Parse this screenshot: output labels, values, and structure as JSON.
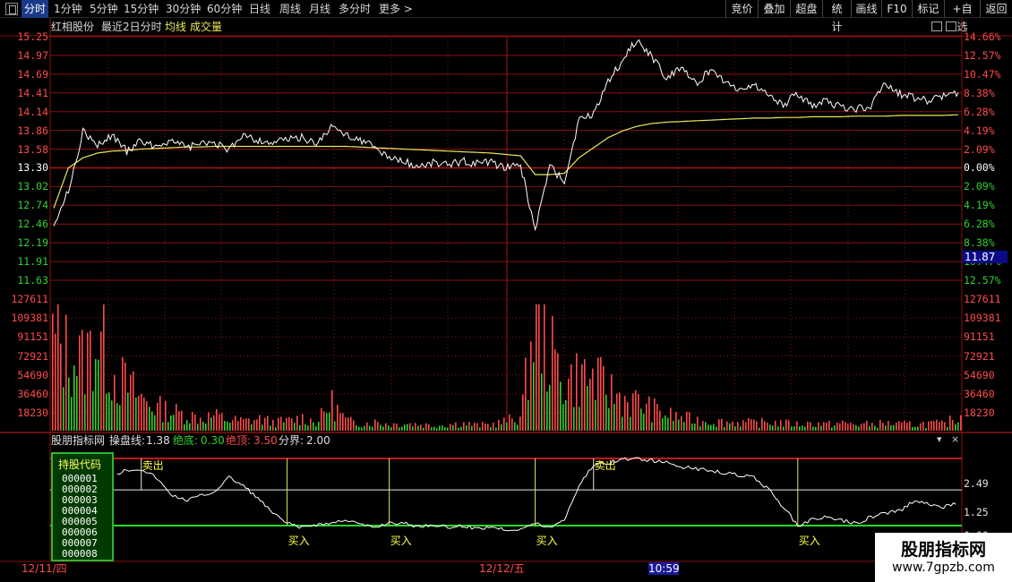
{
  "toolbar": {
    "periods": [
      "分时",
      "1分钟",
      "5分钟",
      "15分钟",
      "30分钟",
      "60分钟",
      "日线",
      "周线",
      "月线",
      "多分时",
      "更多 >"
    ],
    "right_buttons": [
      "竞价",
      "叠加",
      "超盘",
      "统计",
      "画线",
      "F10",
      "标记",
      "+自选",
      "返回"
    ]
  },
  "title": {
    "stock_name": "红相股份",
    "view": "最近2日分时",
    "avg_line": "均线",
    "volume": "成交量"
  },
  "price_axis": {
    "left": [
      "15.25",
      "14.97",
      "14.69",
      "14.41",
      "14.14",
      "13.86",
      "13.58",
      "13.30",
      "13.02",
      "12.74",
      "12.46",
      "12.19",
      "11.91",
      "11.63"
    ],
    "right": [
      "14.66%",
      "12.57%",
      "10.47%",
      "8.38%",
      "6.28%",
      "4.19%",
      "2.09%",
      "0.00%",
      "2.09%",
      "4.19%",
      "6.28%",
      "8.38%",
      "10.47%",
      "12.57%"
    ],
    "right_colors": [
      "#ff4a4a",
      "#ff4a4a",
      "#ff4a4a",
      "#ff4a4a",
      "#ff4a4a",
      "#ff4a4a",
      "#ff4a4a",
      "#ffffff",
      "#2fd12f",
      "#2fd12f",
      "#2fd12f",
      "#2fd12f",
      "#2fd12f",
      "#2fd12f"
    ]
  },
  "current_price": "11.87",
  "volume_axis": [
    "127611",
    "109381",
    "91151",
    "72921",
    "54690",
    "36460",
    "18230"
  ],
  "indicator": {
    "name": "股朋指标网",
    "line_label": "操盘线:",
    "line_value": "1.38",
    "bottom_label": "绝底:",
    "bottom_value": "0.30",
    "top_label": "绝顶:",
    "top_value": "3.50",
    "split_label": "分界:",
    "split_value": "2.00",
    "axis": [
      "2.49",
      "1.25",
      "0.00"
    ],
    "sell_label": "卖出",
    "buy_label": "买入"
  },
  "holdings": {
    "title": "持股代码",
    "codes": [
      "000001",
      "000002",
      "000003",
      "000004",
      "000005",
      "000006",
      "000007",
      "000008"
    ]
  },
  "dates": {
    "d1": "12/11/四",
    "d2": "12/12/五",
    "time": "10:59"
  },
  "watermark": {
    "title": "股朋指标网",
    "url": "www.7gpzb.com"
  },
  "colors": {
    "up": "#ff4a4a",
    "down": "#2fd12f",
    "price_line": "#ffffff",
    "avg_line": "#e8e85a",
    "grid": "#8a1010",
    "indicator_top": "#ff2020",
    "indicator_bottom": "#22dd22"
  },
  "chart_data": {
    "type": "line",
    "title": "红相股份 最近2日分时",
    "days": [
      "12/11/四",
      "12/12/五"
    ],
    "prev_close": 13.3,
    "ylim": [
      11.63,
      15.25
    ],
    "price_series": {
      "name": "分时",
      "values": [
        12.48,
        12.95,
        13.85,
        13.62,
        13.79,
        13.55,
        13.7,
        13.62,
        13.72,
        13.6,
        13.65,
        13.68,
        13.55,
        13.82,
        13.7,
        13.68,
        13.72,
        13.75,
        13.66,
        13.9,
        13.8,
        13.72,
        13.6,
        13.45,
        13.4,
        13.32,
        13.38,
        13.35,
        13.4,
        13.36,
        13.38,
        13.3,
        13.34,
        12.38,
        13.32,
        13.1,
        14.0,
        14.1,
        14.6,
        14.9,
        15.22,
        14.95,
        14.65,
        14.8,
        14.55,
        14.75,
        14.6,
        14.45,
        14.55,
        14.38,
        14.24,
        14.4,
        14.2,
        14.3,
        14.2,
        14.18,
        14.22,
        14.55,
        14.4,
        14.35,
        14.3,
        14.38,
        14.42
      ]
    },
    "avg_series": {
      "name": "均线",
      "values": [
        12.7,
        13.3,
        13.45,
        13.52,
        13.55,
        13.56,
        13.58,
        13.59,
        13.6,
        13.61,
        13.61,
        13.62,
        13.62,
        13.62,
        13.62,
        13.62,
        13.62,
        13.62,
        13.62,
        13.62,
        13.62,
        13.61,
        13.6,
        13.59,
        13.58,
        13.57,
        13.56,
        13.55,
        13.54,
        13.53,
        13.52,
        13.5,
        13.48,
        13.2,
        13.2,
        13.22,
        13.45,
        13.6,
        13.75,
        13.85,
        13.92,
        13.96,
        13.98,
        13.99,
        14.0,
        14.01,
        14.02,
        14.03,
        14.04,
        14.04,
        14.05,
        14.05,
        14.06,
        14.06,
        14.06,
        14.07,
        14.07,
        14.07,
        14.08,
        14.08,
        14.08,
        14.08,
        14.09
      ]
    },
    "volume_ylim": [
      0,
      127611
    ],
    "volume": {
      "name": "成交量",
      "values": [
        85000,
        72000,
        65000,
        90000,
        55000,
        42000,
        30000,
        22000,
        18000,
        15000,
        12000,
        14000,
        10000,
        9000,
        11000,
        8000,
        9000,
        12000,
        8000,
        26000,
        9000,
        7000,
        8000,
        6000,
        7000,
        6000,
        5000,
        6000,
        7000,
        5000,
        6000,
        9000,
        14000,
        115000,
        72000,
        45000,
        52000,
        48000,
        38000,
        30000,
        26000,
        20000,
        15000,
        12000,
        10000,
        9000,
        8000,
        8000,
        7000,
        8000,
        7000,
        6000,
        7000,
        6000,
        7000,
        6000,
        6000,
        7000,
        6000,
        6000,
        7000,
        6000,
        14000
      ]
    },
    "indicator_ylim": [
      0,
      3.5
    ],
    "indicator_series": {
      "name": "操盘线",
      "values": [
        2.8,
        2.7,
        2.85,
        2.75,
        2.7,
        2.95,
        3.0,
        2.6,
        1.8,
        1.5,
        1.7,
        1.9,
        2.6,
        2.2,
        1.6,
        0.9,
        0.4,
        0.2,
        0.35,
        0.4,
        0.6,
        0.35,
        0.2,
        0.45,
        0.4,
        0.25,
        0.35,
        0.2,
        0.3,
        0.15,
        0.25,
        0.1,
        0.15,
        0.4,
        0.2,
        0.6,
        2.2,
        3.2,
        3.3,
        3.45,
        3.5,
        3.4,
        3.3,
        3.1,
        3.0,
        2.95,
        2.8,
        2.7,
        2.6,
        2.0,
        1.2,
        0.3,
        0.6,
        0.7,
        0.55,
        0.4,
        0.7,
        0.9,
        1.0,
        1.5,
        1.3,
        1.2,
        1.38
      ]
    },
    "signals": [
      {
        "type": "卖出",
        "index": 6
      },
      {
        "type": "买入",
        "index": 16
      },
      {
        "type": "买入",
        "index": 23
      },
      {
        "type": "买入",
        "index": 33
      },
      {
        "type": "卖出",
        "index": 37
      },
      {
        "type": "买入",
        "index": 51
      }
    ]
  }
}
